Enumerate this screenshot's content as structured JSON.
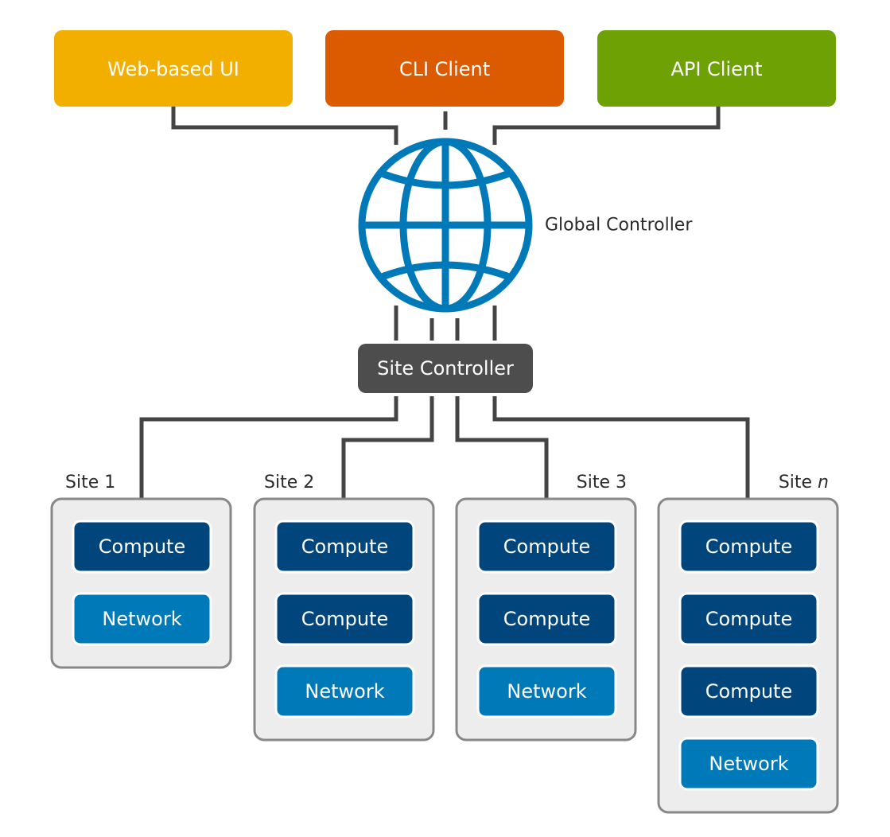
{
  "clients": [
    {
      "label": "Web-based UI",
      "color": "#f2af00"
    },
    {
      "label": "CLI Client",
      "color": "#dc5a00"
    },
    {
      "label": "API Client",
      "color": "#6ea204"
    }
  ],
  "global_controller": {
    "label": "Global Controller",
    "icon": "globe-icon",
    "color": "#0079b9"
  },
  "site_controller": {
    "label": "Site Controller",
    "color": "#4d4d4d"
  },
  "colors": {
    "compute": "#00457c",
    "network": "#0079b9",
    "site_fill": "#ededed",
    "site_border": "#888888",
    "wire": "#444444"
  },
  "sites": [
    {
      "label": "Site 1",
      "label_suffix": "",
      "nodes": [
        "Compute",
        "Network"
      ]
    },
    {
      "label": "Site 2",
      "label_suffix": "",
      "nodes": [
        "Compute",
        "Compute",
        "Network"
      ]
    },
    {
      "label": "Site 3",
      "label_suffix": "",
      "nodes": [
        "Compute",
        "Compute",
        "Network"
      ]
    },
    {
      "label": "Site ",
      "label_suffix": "n",
      "nodes": [
        "Compute",
        "Compute",
        "Compute",
        "Network"
      ]
    }
  ]
}
